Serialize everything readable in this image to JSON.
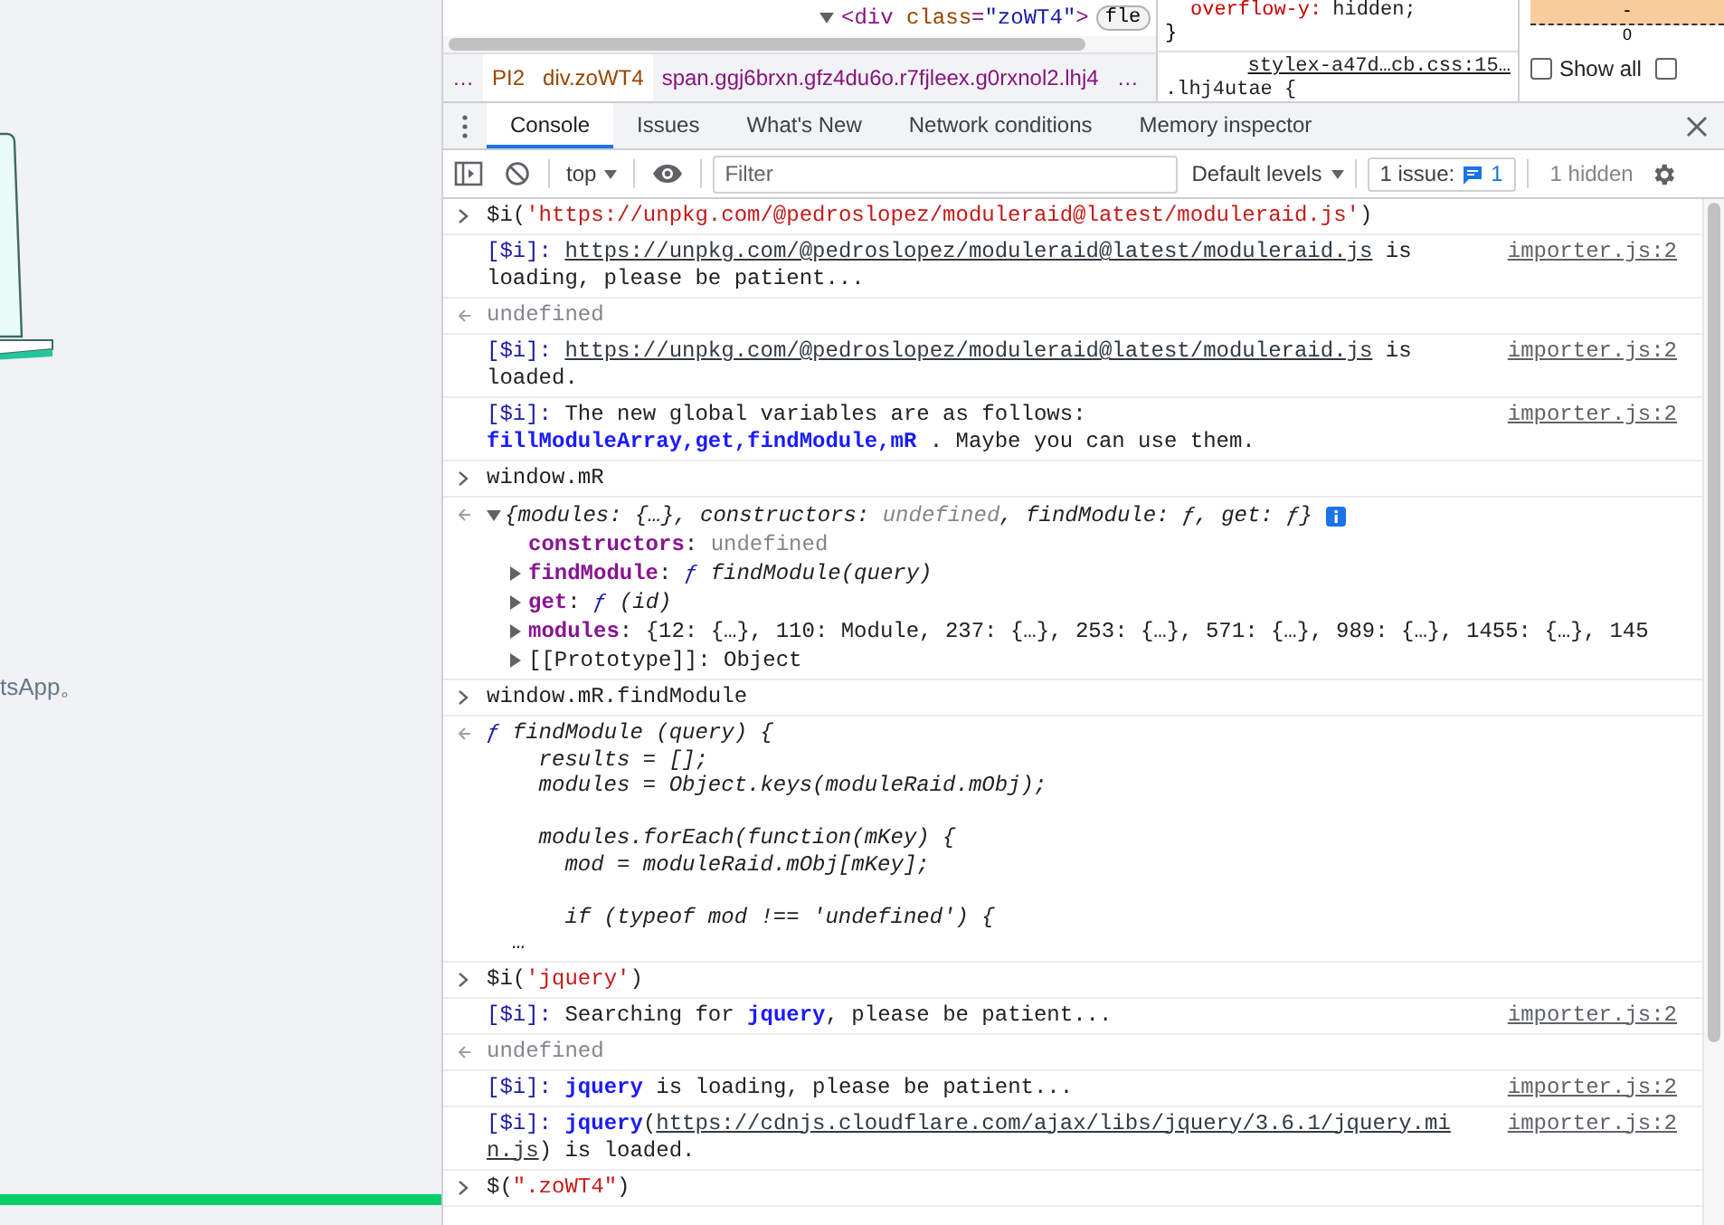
{
  "page": {
    "caption": "tsApp。"
  },
  "elements": {
    "dom_line": {
      "expanded": true,
      "segments": [
        {
          "kind": "tag",
          "text": "<div "
        },
        {
          "kind": "attr",
          "text": "class"
        },
        {
          "kind": "tag",
          "text": "="
        },
        {
          "kind": "value",
          "text": "\"zoWT4\""
        },
        {
          "kind": "tag",
          "text": ">"
        }
      ],
      "badge": "fle"
    },
    "breadcrumbs": [
      {
        "text": "…",
        "selected": false
      },
      {
        "text": "PI2",
        "selected": true
      },
      {
        "text": "div.zoWT4",
        "selected": true
      },
      {
        "text": "span.ggj6brxn.gfz4du6o.r7fjleex.g0rxnol2.lhj4",
        "selected": false
      },
      {
        "text": "…",
        "selected": false
      }
    ]
  },
  "styles": {
    "property": "overflow-y:",
    "value": "hidden;",
    "close": "}",
    "source": "stylex-a47d…cb.css:15…",
    "selector": ".lhj4utae {"
  },
  "computed": {
    "box_top": "-",
    "box_value": "0",
    "options": [
      {
        "label": "Show all",
        "checked": false
      },
      {
        "checked": false
      }
    ]
  },
  "drawer": {
    "tabs": [
      {
        "label": "Console",
        "selected": true
      },
      {
        "label": "Issues",
        "selected": false
      },
      {
        "label": "What's New",
        "selected": false
      },
      {
        "label": "Network conditions",
        "selected": false
      },
      {
        "label": "Memory inspector",
        "selected": false
      }
    ]
  },
  "toolbar": {
    "context": "top",
    "filter_placeholder": "Filter",
    "levels": "Default levels",
    "issues_label": "1 issue:",
    "issues_count": "1",
    "hidden": "1 hidden"
  },
  "console": [
    {
      "kind": "input",
      "segments": [
        {
          "kind": "plain",
          "text": "$i("
        },
        {
          "kind": "string",
          "text": "'https://unpkg.com/@pedroslopez/moduleraid@latest/moduleraid.js'"
        },
        {
          "kind": "plain",
          "text": ")"
        }
      ]
    },
    {
      "kind": "log",
      "source": "importer.js:2",
      "segments": [
        {
          "kind": "prefix",
          "text": "[$i]: "
        },
        {
          "kind": "link",
          "text": "https://unpkg.com/@pedroslopez/moduleraid@latest/moduleraid.js"
        },
        {
          "kind": "plain",
          "text": " is loading, please be patient..."
        }
      ]
    },
    {
      "kind": "result",
      "segments": [
        {
          "kind": "muted",
          "text": "undefined"
        }
      ]
    },
    {
      "kind": "log",
      "source": "importer.js:2",
      "segments": [
        {
          "kind": "prefix",
          "text": "[$i]: "
        },
        {
          "kind": "link",
          "text": "https://unpkg.com/@pedroslopez/moduleraid@latest/moduleraid.js"
        },
        {
          "kind": "plain",
          "text": " is loaded."
        }
      ]
    },
    {
      "kind": "log",
      "source": "importer.js:2",
      "segments": [
        {
          "kind": "prefix",
          "text": "[$i]:"
        },
        {
          "kind": "plain",
          "text": " The new global variables are as follows: "
        },
        {
          "kind": "bold",
          "text": "fillModuleArray,get,findModule,mR"
        },
        {
          "kind": "plain",
          "text": " . Maybe you can use them."
        }
      ]
    },
    {
      "kind": "input",
      "segments": [
        {
          "kind": "plain",
          "text": "window.mR"
        }
      ]
    },
    {
      "kind": "object",
      "expanded": true,
      "preview": [
        {
          "kind": "italic",
          "text": "{modules: {…}, constructors: "
        },
        {
          "kind": "muted_italic",
          "text": "undefined"
        },
        {
          "kind": "italic",
          "text": ", findModule: ƒ, get: ƒ}"
        }
      ],
      "properties": [
        {
          "expandable": false,
          "segments": [
            {
              "kind": "key",
              "text": "constructors"
            },
            {
              "kind": "plain",
              "text": ": "
            },
            {
              "kind": "muted",
              "text": "undefined"
            }
          ]
        },
        {
          "expandable": true,
          "segments": [
            {
              "kind": "key",
              "text": "findModule"
            },
            {
              "kind": "plain",
              "text": ": "
            },
            {
              "kind": "fn",
              "text": "ƒ"
            },
            {
              "kind": "italic",
              "text": " findModule(query)"
            }
          ]
        },
        {
          "expandable": true,
          "segments": [
            {
              "kind": "key",
              "text": "get"
            },
            {
              "kind": "plain",
              "text": ": "
            },
            {
              "kind": "fn",
              "text": "ƒ"
            },
            {
              "kind": "italic",
              "text": " (id)"
            }
          ]
        },
        {
          "expandable": true,
          "segments": [
            {
              "kind": "key",
              "text": "modules"
            },
            {
              "kind": "plain",
              "text": ": {12: {…}, 110: Module, 237: {…}, 253: {…}, 571: {…}, 989: {…}, 1455: {…}, 145"
            }
          ]
        },
        {
          "expandable": true,
          "segments": [
            {
              "kind": "plain",
              "text": "[[Prototype]]: Object"
            }
          ]
        }
      ]
    },
    {
      "kind": "input",
      "segments": [
        {
          "kind": "plain",
          "text": "window.mR.findModule"
        }
      ]
    },
    {
      "kind": "function",
      "prefix": "ƒ",
      "code": " findModule (query) {\n    results = [];\n    modules = Object.keys(moduleRaid.mObj);\n\n    modules.forEach(function(mKey) {\n      mod = moduleRaid.mObj[mKey];\n\n      if (typeof mod !== 'undefined') {\n  …"
    },
    {
      "kind": "input",
      "segments": [
        {
          "kind": "plain",
          "text": "$i("
        },
        {
          "kind": "string",
          "text": "'jquery'"
        },
        {
          "kind": "plain",
          "text": ")"
        }
      ]
    },
    {
      "kind": "log",
      "source": "importer.js:2",
      "segments": [
        {
          "kind": "prefix",
          "text": "[$i]:"
        },
        {
          "kind": "plain",
          "text": " Searching for "
        },
        {
          "kind": "bold",
          "text": "jquery"
        },
        {
          "kind": "plain",
          "text": ", please be patient..."
        }
      ]
    },
    {
      "kind": "result",
      "segments": [
        {
          "kind": "muted",
          "text": "undefined"
        }
      ]
    },
    {
      "kind": "log",
      "source": "importer.js:2",
      "segments": [
        {
          "kind": "prefix",
          "text": "[$i]: "
        },
        {
          "kind": "bold",
          "text": "jquery"
        },
        {
          "kind": "plain",
          "text": " is loading, please be patient..."
        }
      ]
    },
    {
      "kind": "log",
      "source": "importer.js:2",
      "segments": [
        {
          "kind": "prefix",
          "text": "[$i]: "
        },
        {
          "kind": "bold",
          "text": "jquery"
        },
        {
          "kind": "plain",
          "text": "("
        },
        {
          "kind": "link",
          "text": "https://cdnjs.cloudflare.com/ajax/libs/jquery/3.6.1/jquery.min.js"
        },
        {
          "kind": "plain",
          "text": ") is loaded."
        }
      ]
    },
    {
      "kind": "input",
      "segments": [
        {
          "kind": "plain",
          "text": "$("
        },
        {
          "kind": "string",
          "text": "\".zoWT4\""
        },
        {
          "kind": "plain",
          "text": ")"
        }
      ]
    }
  ]
}
